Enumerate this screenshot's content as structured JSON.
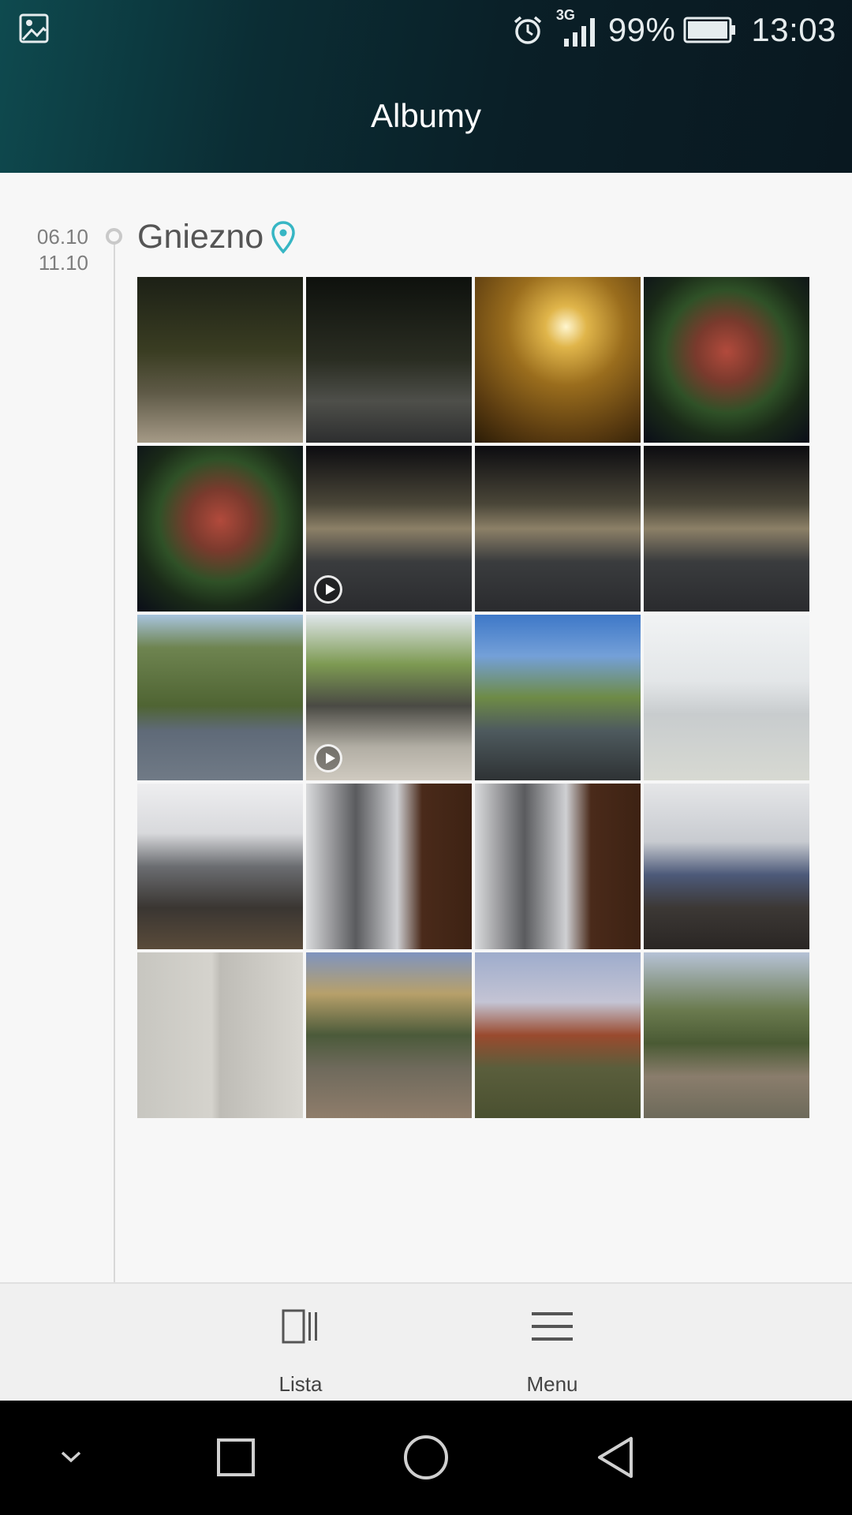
{
  "status_bar": {
    "network": "3G",
    "battery": "99%",
    "time": "13:03",
    "icons": [
      "gallery-icon",
      "alarm-icon",
      "signal-icon",
      "battery-icon"
    ]
  },
  "header": {
    "title": "Albumy"
  },
  "album": {
    "date_start": "06.10",
    "date_end": "11.10",
    "location": "Gniezno",
    "location_icon": "location-pin-icon",
    "accent_color": "#37b6c4",
    "thumbnails": [
      {
        "type": "photo",
        "scene": "night-street"
      },
      {
        "type": "photo",
        "scene": "night-road"
      },
      {
        "type": "photo",
        "scene": "street-lamp"
      },
      {
        "type": "photo",
        "scene": "flower-basket"
      },
      {
        "type": "photo",
        "scene": "flower-basket"
      },
      {
        "type": "video",
        "scene": "night-city-street"
      },
      {
        "type": "photo",
        "scene": "night-city-street"
      },
      {
        "type": "photo",
        "scene": "night-city-street"
      },
      {
        "type": "photo",
        "scene": "road-trees"
      },
      {
        "type": "video",
        "scene": "sidewalk"
      },
      {
        "type": "photo",
        "scene": "square-trees"
      },
      {
        "type": "photo",
        "scene": "document"
      },
      {
        "type": "photo",
        "scene": "room-window"
      },
      {
        "type": "photo",
        "scene": "room-wardrobe"
      },
      {
        "type": "photo",
        "scene": "room-wardrobe"
      },
      {
        "type": "photo",
        "scene": "room-desk"
      },
      {
        "type": "photo",
        "scene": "room-corner"
      },
      {
        "type": "photo",
        "scene": "park-blocks"
      },
      {
        "type": "photo",
        "scene": "house"
      },
      {
        "type": "photo",
        "scene": "park-trees"
      }
    ]
  },
  "bottom_bar": {
    "list_label": "Lista",
    "menu_label": "Menu"
  },
  "nav_bar": {
    "buttons": [
      "collapse-icon",
      "recent-apps-icon",
      "home-icon",
      "back-icon"
    ]
  }
}
